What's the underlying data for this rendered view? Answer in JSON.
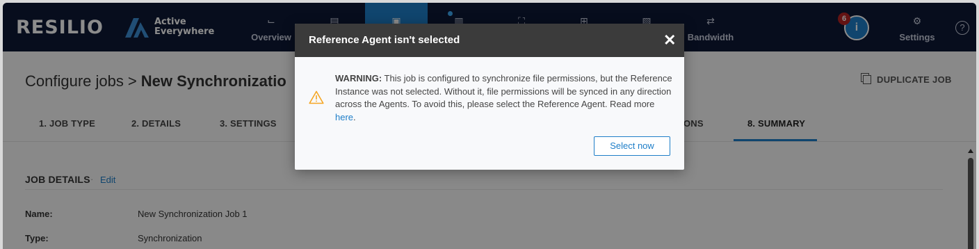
{
  "brand": {
    "name": "RESILIO",
    "product_line1": "Active",
    "product_line2": "Everywhere"
  },
  "nav": {
    "items": [
      {
        "label": "Overview",
        "icon": "chart-icon",
        "glyph": "⌙"
      },
      {
        "label": "",
        "icon": "jobs-icon",
        "glyph": "▤"
      },
      {
        "label": "",
        "icon": "configure-jobs-icon",
        "glyph": "▣"
      },
      {
        "label": "",
        "icon": "agents-icon",
        "glyph": "▥"
      },
      {
        "label": "",
        "icon": "groups-icon",
        "glyph": "⛶"
      },
      {
        "label": "",
        "icon": "storage-icon",
        "glyph": "⊞"
      },
      {
        "label": "",
        "icon": "reports-icon",
        "glyph": "▧"
      },
      {
        "label": "Bandwidth",
        "icon": "bandwidth-icon",
        "glyph": "⇄"
      },
      {
        "label": "Settings",
        "icon": "gear-icon",
        "glyph": "⚙"
      }
    ],
    "notification_count": "6",
    "info_glyph": "i",
    "help_glyph": "?"
  },
  "page": {
    "breadcrumb_root": "Configure jobs",
    "breadcrumb_sep": ">",
    "breadcrumb_current": "New Synchronizatio",
    "duplicate_label": "DUPLICATE JOB",
    "tabs": [
      "1. JOB TYPE",
      "2. DETAILS",
      "3. SETTINGS",
      "ONS",
      "8. SUMMARY"
    ],
    "active_tab": "8. SUMMARY",
    "section_title": "JOB DETAILS",
    "section_dot": "·",
    "section_edit": "Edit",
    "rows": [
      {
        "key": "Name:",
        "value": "New Synchronization Job 1"
      },
      {
        "key": "Type:",
        "value": "Synchronization"
      }
    ]
  },
  "modal": {
    "title": "Reference Agent isn't selected",
    "close_glyph": "✕",
    "warning_lead": "WARNING:",
    "warning_body": " This job is configured to synchronize file permissions, but the Reference Instance was not selected. Without it, file permissions will be synced in any direction across the Agents. To avoid this, please select the Reference Agent. Read more ",
    "link_text": "here",
    "trailing": ".",
    "primary_button": "Select now"
  },
  "colors": {
    "navbar": "#0e1835",
    "accent": "#1e7ec8",
    "warning": "#f5a623",
    "badge": "#b42323"
  }
}
